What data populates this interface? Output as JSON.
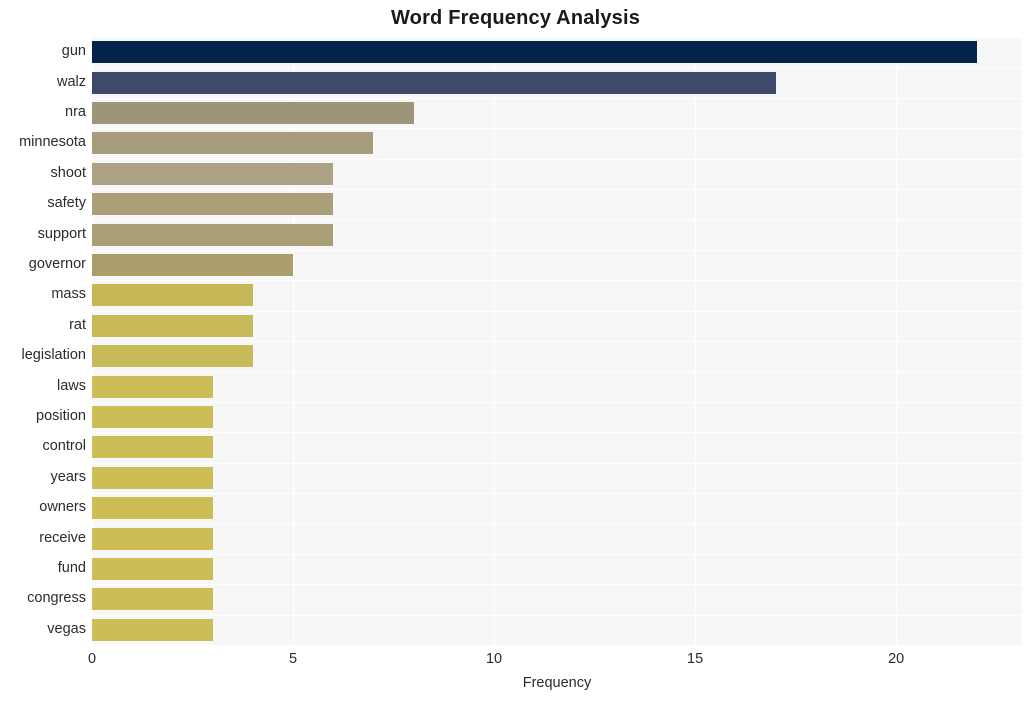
{
  "chart_data": {
    "type": "bar",
    "orientation": "horizontal",
    "title": "Word Frequency Analysis",
    "xlabel": "Frequency",
    "ylabel": "",
    "categories": [
      "gun",
      "walz",
      "nra",
      "minnesota",
      "shoot",
      "safety",
      "support",
      "governor",
      "mass",
      "rat",
      "legislation",
      "laws",
      "position",
      "control",
      "years",
      "owners",
      "receive",
      "fund",
      "congress",
      "vegas"
    ],
    "values": [
      22,
      17,
      8,
      7,
      6,
      6,
      6,
      5,
      4,
      4,
      4,
      3,
      3,
      3,
      3,
      3,
      3,
      3,
      3,
      3
    ],
    "bar_colors": [
      "#04234b",
      "#3f4a6b",
      "#9d9479",
      "#a79d7c",
      "#ada184",
      "#ab9f79",
      "#aa9e77",
      "#ab9d6e",
      "#c6b857",
      "#c9ba59",
      "#c9ba59",
      "#cdbd57",
      "#cdbd57",
      "#cdbd57",
      "#cdbd57",
      "#cdbd57",
      "#cdbd57",
      "#cdbd57",
      "#cdbd57",
      "#cdbd57"
    ],
    "xlim": [
      0,
      23.13
    ],
    "xticks": [
      0,
      5,
      10,
      15,
      20
    ],
    "xtick_labels": [
      "0",
      "5",
      "10",
      "15",
      "20"
    ],
    "grid": true,
    "grid_color": "#ffffff",
    "plot_background": "#f7f7f7",
    "figure_background": "#ffffff",
    "legend": null
  }
}
